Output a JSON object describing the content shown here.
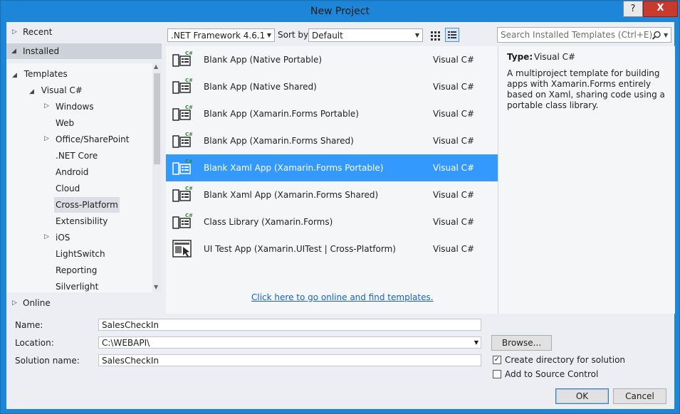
{
  "window": {
    "title": "New Project",
    "help": "?",
    "close": "X"
  },
  "nav": {
    "recent": "Recent",
    "installed": "Installed",
    "online": "Online",
    "tree": {
      "templates": "Templates",
      "visual_csharp": "Visual C#",
      "items": [
        "Windows",
        "Web",
        "Office/SharePoint",
        ".NET Core",
        "Android",
        "Cloud",
        "Cross-Platform",
        "Extensibility",
        "iOS",
        "LightSwitch",
        "Reporting",
        "Silverlight"
      ]
    }
  },
  "toolbar": {
    "framework": ".NET Framework 4.6.1",
    "sort_label": "Sort by:",
    "sort_value": "Default",
    "search_placeholder": "Search Installed Templates (Ctrl+E)"
  },
  "templates": [
    {
      "name": "Blank App (Native Portable)",
      "lang": "Visual C#"
    },
    {
      "name": "Blank App (Native Shared)",
      "lang": "Visual C#"
    },
    {
      "name": "Blank App (Xamarin.Forms Portable)",
      "lang": "Visual C#"
    },
    {
      "name": "Blank App (Xamarin.Forms Shared)",
      "lang": "Visual C#"
    },
    {
      "name": "Blank Xaml App (Xamarin.Forms Portable)",
      "lang": "Visual C#"
    },
    {
      "name": "Blank Xaml App (Xamarin.Forms Shared)",
      "lang": "Visual C#"
    },
    {
      "name": "Class Library (Xamarin.Forms)",
      "lang": "Visual C#"
    },
    {
      "name": "UI Test App (Xamarin.UITest | Cross-Platform)",
      "lang": "Visual C#"
    }
  ],
  "selected_template_index": 4,
  "online_link": "Click here to go online and find templates.",
  "description": {
    "type_label": "Type:",
    "type_value": "Visual C#",
    "text": "A multiproject template for building apps with Xamarin.Forms entirely based on Xaml, sharing code using a portable class library."
  },
  "form": {
    "name_label": "Name:",
    "name_value": "SalesCheckIn",
    "location_label": "Location:",
    "location_value": "C:\\WEBAPI\\",
    "solution_label": "Solution name:",
    "solution_value": "SalesCheckIn",
    "browse": "Browse...",
    "create_dir": "Create directory for solution",
    "create_dir_checked": true,
    "add_source": "Add to Source Control",
    "add_source_checked": false,
    "ok": "OK",
    "cancel": "Cancel"
  },
  "colors": {
    "accent": "#3399ff",
    "title_bar": "#1e86d8",
    "close": "#c83a2d",
    "link": "#1a5fd1"
  }
}
